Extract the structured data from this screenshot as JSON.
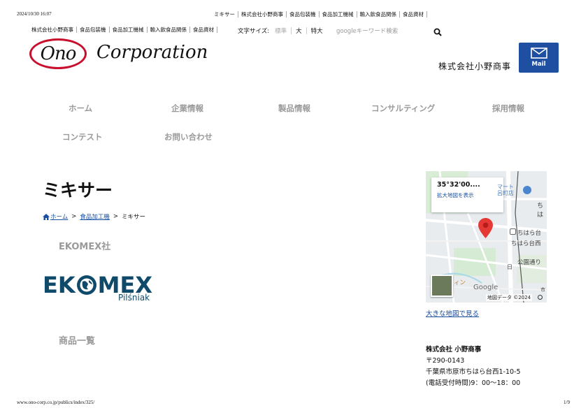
{
  "print_header": {
    "date": "2024/10/30 16:07"
  },
  "print_footer": {
    "url": "www.ono-corp.co.jp/publics/index/325/",
    "page": "1/9"
  },
  "top_nav": [
    "ミキサー",
    "株式会社小野商事",
    "食品包装機",
    "食品加工機械",
    "輸入飲食品関係",
    "食品資材"
  ],
  "sub_nav": [
    "株式会社小野商事",
    "食品包装機",
    "食品加工機械",
    "輸入飲食品関係",
    "食品資材"
  ],
  "font_size": {
    "label": "文字サイズ:",
    "options": [
      "標準",
      "大",
      "特大"
    ]
  },
  "search": {
    "placeholder": "googleキーワード検索"
  },
  "logo": {
    "oval_text": "Ono",
    "corp_text": "Corporation"
  },
  "header": {
    "company_name": "株式会社小野商事",
    "mail_label": "Mail"
  },
  "main_nav": [
    "ホーム",
    "企業情報",
    "製品情報",
    "コンサルティング",
    "採用情報",
    "コンテスト",
    "お問い合わせ"
  ],
  "page": {
    "title": "ミキサー"
  },
  "breadcrumb": {
    "home": "ホーム",
    "category": "食品加工機",
    "current": "ミキサー",
    "separator": ">"
  },
  "maker": {
    "heading": "EKOMEX社",
    "logo_word_left": "EK",
    "logo_word_right": "MEX",
    "logo_sub": "Pilśniak"
  },
  "products": {
    "heading": "商品一覧"
  },
  "map": {
    "coord": "35°32'00....",
    "enlarge": "拡大地図を表示",
    "labels": [
      "マート",
      "呂町店",
      "ちは",
      "ちはら台",
      "ちはら台西",
      "公園通り",
      "ィン",
      "日",
      "市"
    ],
    "google": "Google",
    "map_data": "地図データ ©2024",
    "big_map_link": "大きな地図で見る"
  },
  "address": {
    "name": "株式会社 小野商事",
    "postal": "〒290-0143",
    "street": "千葉県市原市ちはら台西1-10-5",
    "hours": "(電話受付時間)9：00〜18：00"
  },
  "colors": {
    "brand_red": "#c8102e",
    "mail_blue": "#1e4fa0",
    "link_blue": "#1a4fa0",
    "ekomex_teal": "#0f4a6a",
    "nav_gray": "#9a9a9a"
  }
}
